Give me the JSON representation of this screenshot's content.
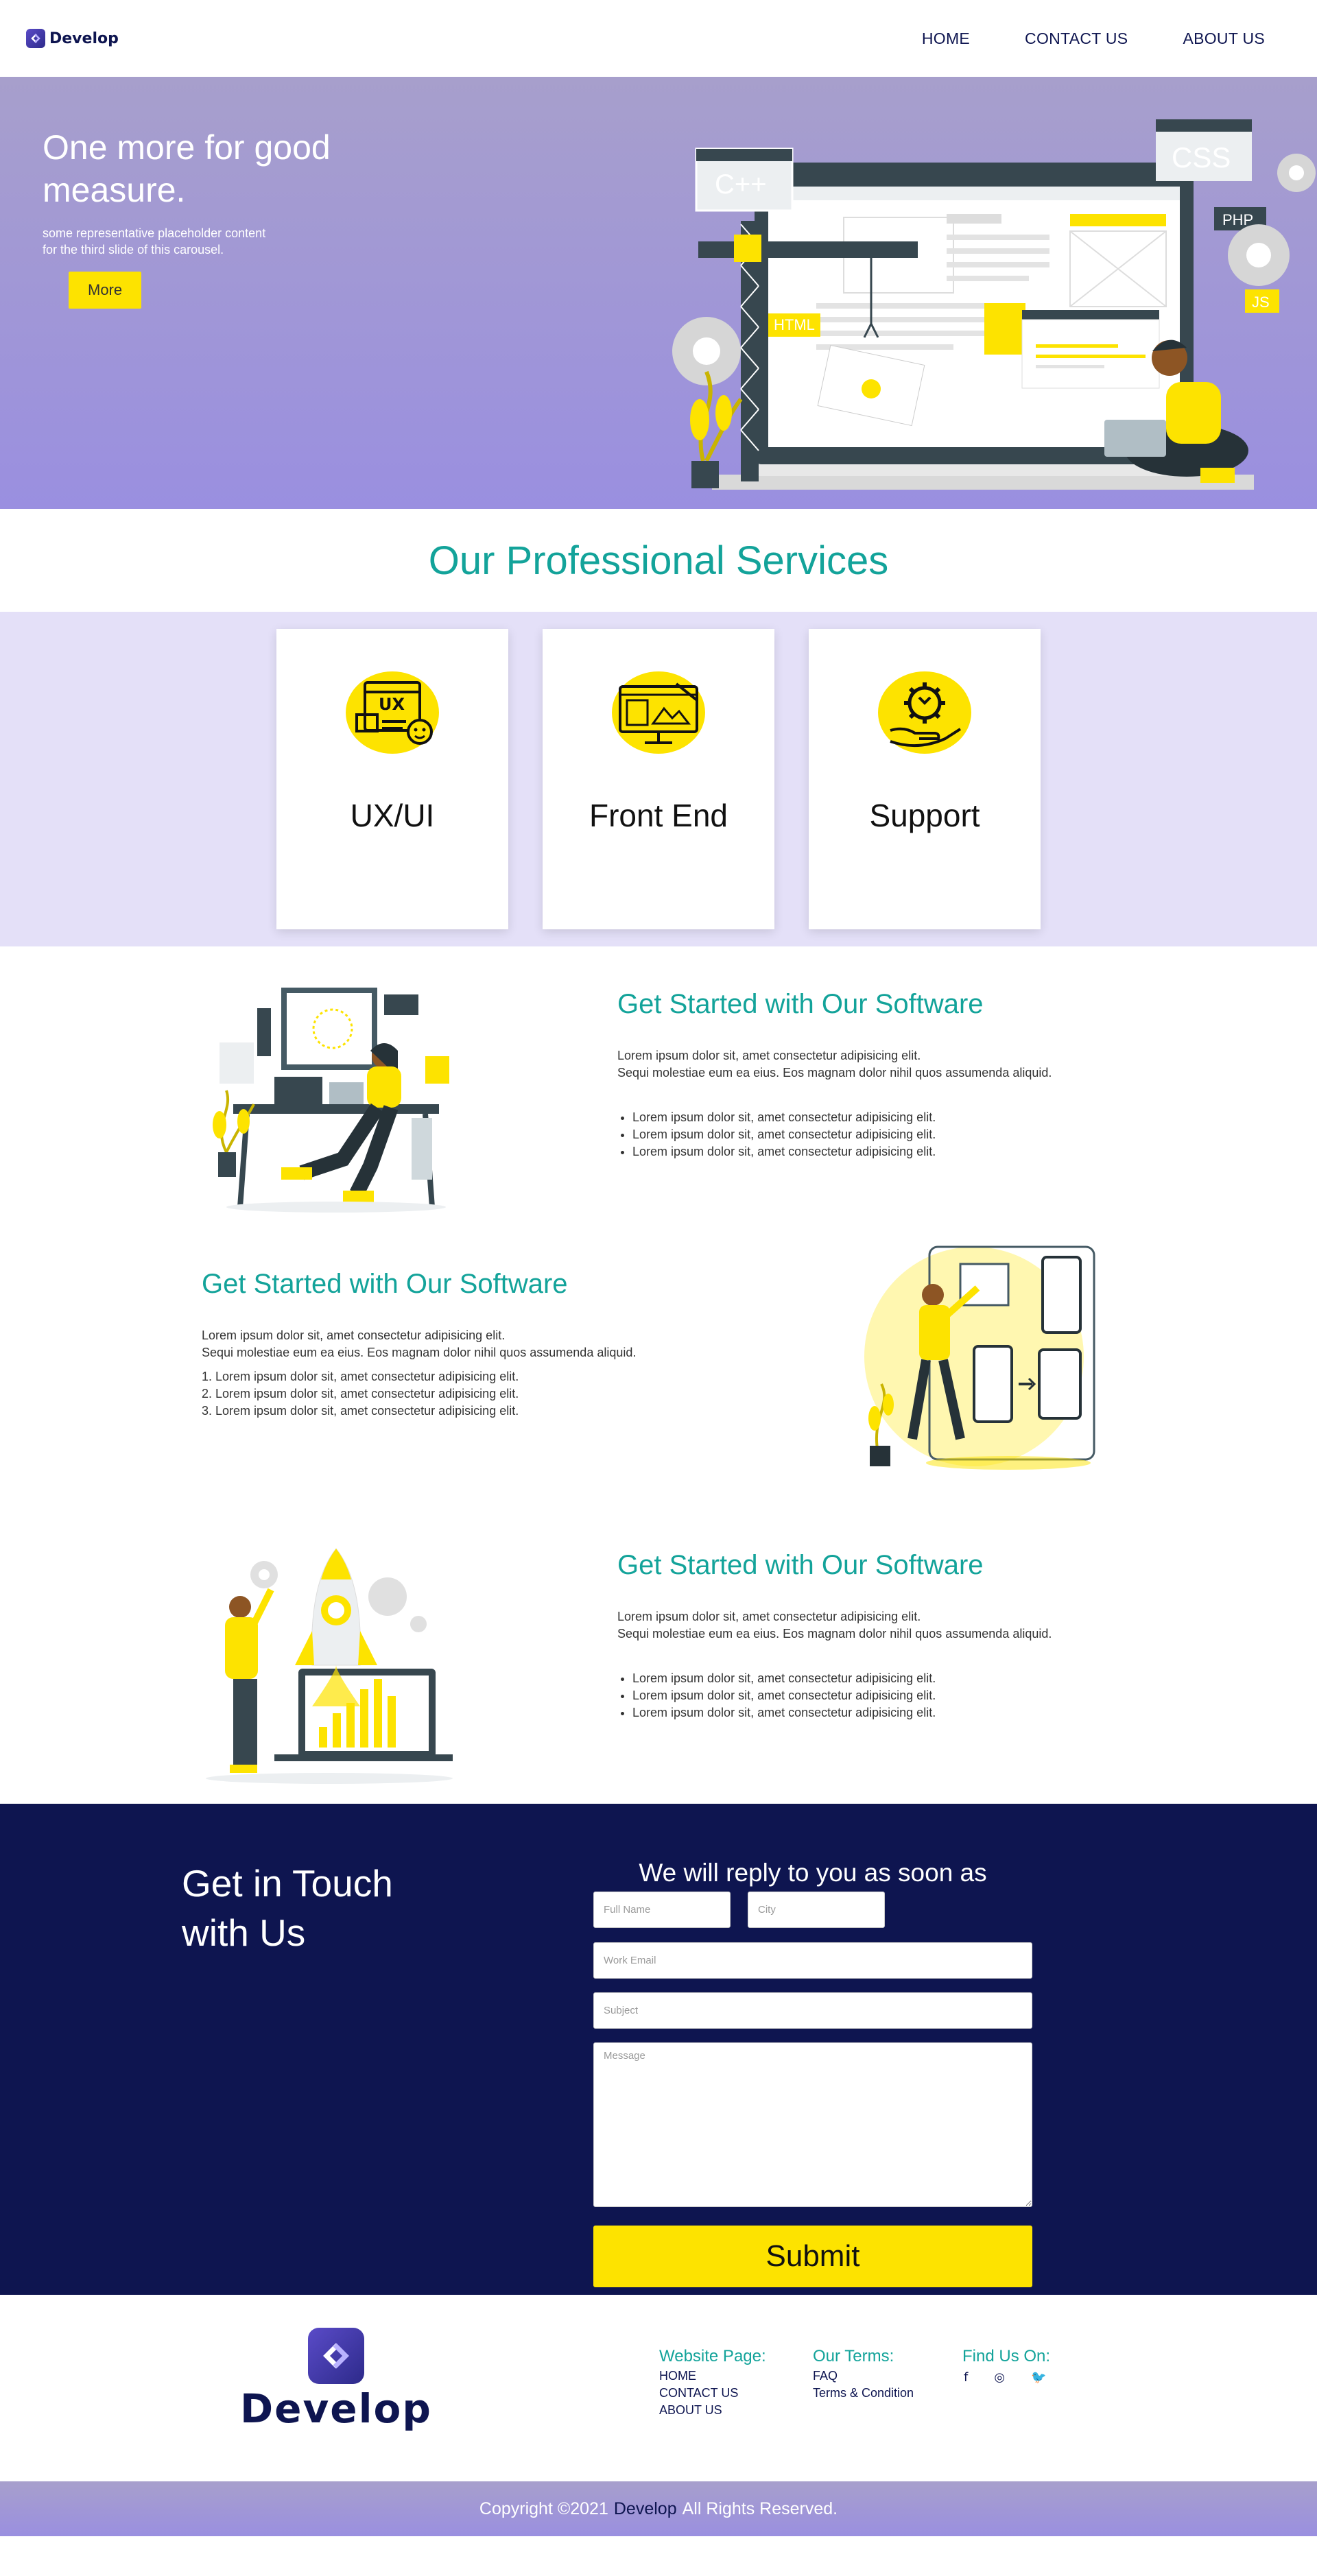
{
  "navbar": {
    "brand": "Develop",
    "links": [
      "HOME",
      "CONTACT US",
      "ABOUT US"
    ]
  },
  "hero": {
    "title": "One more for good measure.",
    "description": "some representative placeholder content for the third slide of this carousel.",
    "button": "More",
    "illustration_labels": {
      "cpp": "C++",
      "css": "CSS",
      "php": "PHP",
      "js": "JS",
      "html": "HTML"
    }
  },
  "services": {
    "heading": "Our Professional Services",
    "cards": [
      {
        "label": "UX/UI",
        "icon": "ux-design-icon",
        "icon_text": "UX"
      },
      {
        "label": "Front End",
        "icon": "front-end-monitor-icon"
      },
      {
        "label": "Support",
        "icon": "support-gear-hand-icon"
      }
    ]
  },
  "features": [
    {
      "title": "Get Started with Our Software",
      "body_line1": "Lorem ipsum dolor sit, amet consectetur adipisicing elit.",
      "body_line2": "Sequi molestiae eum ea eius. Eos magnam dolor nihil quos assumenda aliquid.",
      "list_type": "bullet",
      "items": [
        "Lorem ipsum dolor sit, amet consectetur adipisicing elit.",
        "Lorem ipsum dolor sit, amet consectetur adipisicing elit.",
        "Lorem ipsum dolor sit, amet consectetur adipisicing elit."
      ]
    },
    {
      "title": "Get Started with Our Software",
      "body_line1": "Lorem ipsum dolor sit, amet consectetur adipisicing elit.",
      "body_line2": "Sequi molestiae eum ea eius. Eos magnam dolor nihil quos assumenda aliquid.",
      "list_type": "numbered",
      "items": [
        "Lorem ipsum dolor sit, amet consectetur adipisicing elit.",
        "Lorem ipsum dolor sit, amet consectetur adipisicing elit.",
        "Lorem ipsum dolor sit, amet consectetur adipisicing elit."
      ]
    },
    {
      "title": "Get Started with Our Software",
      "body_line1": "Lorem ipsum dolor sit, amet consectetur adipisicing elit.",
      "body_line2": "Sequi molestiae eum ea eius. Eos magnam dolor nihil quos assumenda aliquid.",
      "list_type": "bullet",
      "items": [
        "Lorem ipsum dolor sit, amet consectetur adipisicing elit.",
        "Lorem ipsum dolor sit, amet consectetur adipisicing elit.",
        "Lorem ipsum dolor sit, amet consectetur adipisicing elit."
      ]
    }
  ],
  "contact": {
    "title": "Get in Touch with Us",
    "subtitle": "We will reply to you as soon as possible",
    "placeholders": {
      "full_name": "Full Name",
      "city": "City",
      "email": "Work Email",
      "subject": "Subject",
      "message": "Message"
    },
    "submit": "Submit"
  },
  "footer": {
    "brand": "Develop",
    "website_title": "Website Page:",
    "website_links": [
      "HOME",
      "CONTACT US",
      "ABOUT US"
    ],
    "terms_title": "Our Terms:",
    "terms_links": [
      "FAQ",
      "Terms & Condition"
    ],
    "social_title": "Find Us On:",
    "social_icons": [
      "facebook-icon",
      "instagram-icon",
      "twitter-icon"
    ],
    "social_glyphs": [
      "f",
      "◎",
      "🐦"
    ]
  },
  "copyright": {
    "prefix": "Copyright ©2021",
    "brand": "Develop",
    "suffix": "All Rights Reserved."
  },
  "colors": {
    "accent": "#13a39a",
    "navy": "#0e1550",
    "yellow": "#fde300",
    "lavender": "#e4e0f8",
    "hero_purple": "#9a8fe0"
  }
}
